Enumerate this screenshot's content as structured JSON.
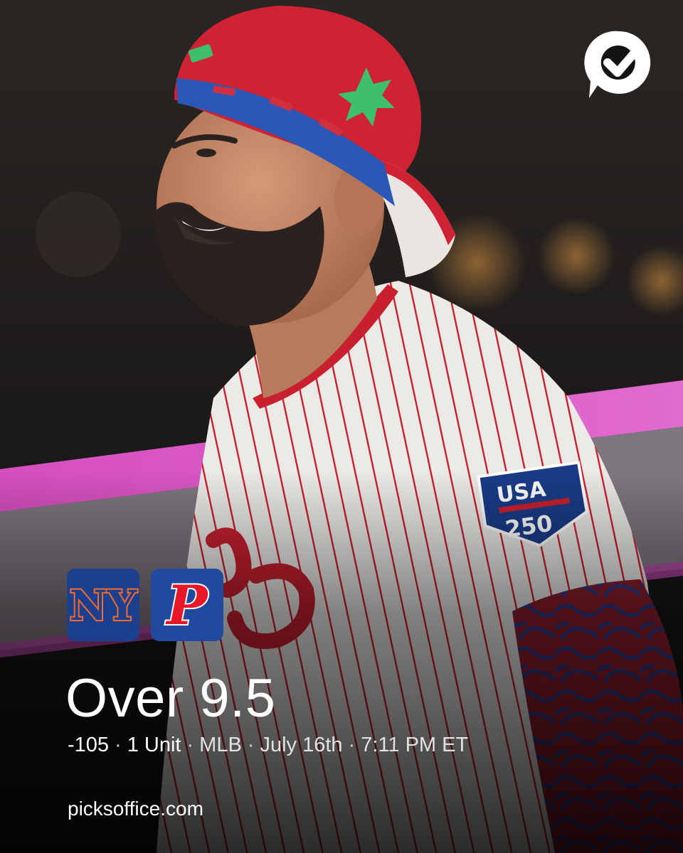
{
  "brand": {
    "logo_icon": "speech-bubble-checkmark-icon"
  },
  "photo": {
    "subject": "player-photo",
    "patch_text": "USA 250"
  },
  "teams": [
    {
      "name": "mets",
      "logo_icon": "mets-ny-logo-icon",
      "logo_text": "NY",
      "color": "#f26b2a"
    },
    {
      "name": "phillies",
      "logo_icon": "phillies-p-logo-icon",
      "logo_text": "P",
      "color": "#e81828"
    }
  ],
  "pick": {
    "title": "Over 9.5",
    "odds": "-105",
    "units": "1 Unit",
    "league": "MLB",
    "date": "July 16th",
    "time": "7:11 PM ET",
    "separator": "·"
  },
  "footer": {
    "url": "picksoffice.com"
  },
  "colors": {
    "text": "#ffffff",
    "jersey_pinstripe": "#c8202f",
    "cap_red": "#c8202f",
    "background": "#141414"
  }
}
